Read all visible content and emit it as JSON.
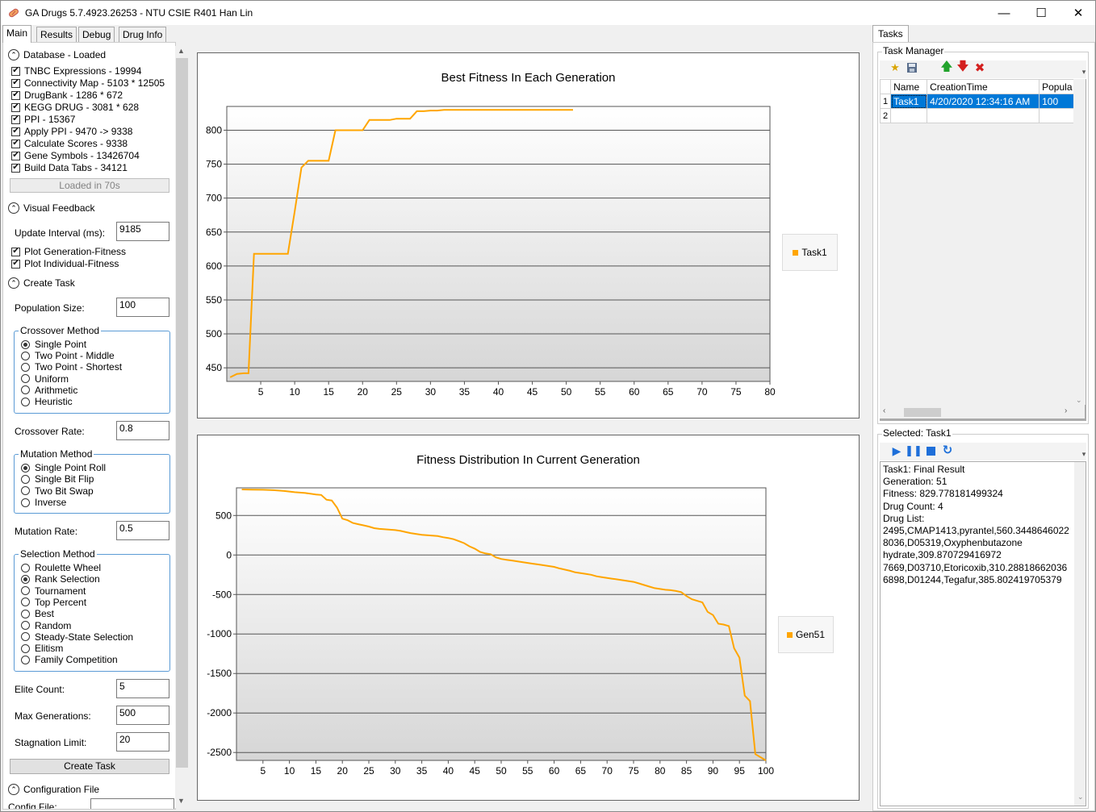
{
  "window": {
    "title": "GA Drugs 5.7.4923.26253 - NTU CSIE R401 Han Lin",
    "minimize": "—",
    "maximize": "☐",
    "close": "✕"
  },
  "tabs": [
    "Main",
    "Results",
    "Debug",
    "Drug Info"
  ],
  "database": {
    "header": "Database - Loaded",
    "items": [
      "TNBC Expressions - 19994",
      "Connectivity Map - 5103 * 12505",
      "DrugBank - 1286 * 672",
      "KEGG DRUG - 3081 * 628",
      "PPI - 15367",
      "Apply PPI - 9470 -> 9338",
      "Calculate Scores - 9338",
      "Gene Symbols - 13426704",
      "Build Data Tabs - 34121"
    ],
    "loaded_button": "Loaded in 70s"
  },
  "visual_feedback": {
    "header": "Visual Feedback",
    "update_interval_label": "Update Interval (ms):",
    "update_interval_value": "9185",
    "plot_generation": "Plot Generation-Fitness",
    "plot_individual": "Plot Individual-Fitness"
  },
  "create_task": {
    "header": "Create Task",
    "population_label": "Population Size:",
    "population_value": "100",
    "crossover_title": "Crossover Method",
    "crossover_options": [
      "Single Point",
      "Two Point - Middle",
      "Two Point - Shortest",
      "Uniform",
      "Arithmetic",
      "Heuristic"
    ],
    "crossover_selected": 0,
    "crossover_rate_label": "Crossover Rate:",
    "crossover_rate_value": "0.8",
    "mutation_title": "Mutation Method",
    "mutation_options": [
      "Single Point Roll",
      "Single Bit Flip",
      "Two Bit Swap",
      "Inverse"
    ],
    "mutation_selected": 0,
    "mutation_rate_label": "Mutation Rate:",
    "mutation_rate_value": "0.5",
    "selection_title": "Selection Method",
    "selection_options": [
      "Roulette Wheel",
      "Rank Selection",
      "Tournament",
      "Top Percent",
      "Best",
      "Random",
      "Steady-State Selection",
      "Elitism",
      "Family Competition"
    ],
    "selection_selected": 1,
    "elite_label": "Elite Count:",
    "elite_value": "5",
    "max_gen_label": "Max Generations:",
    "max_gen_value": "500",
    "stagnation_label": "Stagnation Limit:",
    "stagnation_value": "20",
    "create_button": "Create Task"
  },
  "config": {
    "header": "Configuration File",
    "file_label": "Config File:"
  },
  "chart_data": [
    {
      "type": "line",
      "title": "Best Fitness In Each Generation",
      "xlim": [
        0,
        80
      ],
      "ylim": [
        430,
        835
      ],
      "xticks": [
        5,
        10,
        15,
        20,
        25,
        30,
        35,
        40,
        45,
        50,
        55,
        60,
        65,
        70,
        75,
        80
      ],
      "yticks": [
        450,
        500,
        550,
        600,
        650,
        700,
        750,
        800
      ],
      "grid": true,
      "legend_position": "right",
      "color": "#ffa500",
      "series": [
        {
          "name": "Task1",
          "x": [
            0.5,
            1.5,
            2.5,
            3.2,
            4,
            5,
            6,
            7,
            8,
            9,
            10,
            11,
            12,
            13,
            14,
            15,
            16,
            17,
            18,
            19,
            20,
            21,
            22,
            23,
            24,
            25,
            26,
            27,
            28,
            29,
            30,
            31,
            32,
            33,
            34,
            35,
            36,
            37,
            38,
            39,
            40,
            41,
            42,
            43,
            44,
            45,
            46,
            47,
            48,
            49,
            50,
            51
          ],
          "y": [
            436,
            441,
            442,
            442,
            618,
            618,
            618,
            618,
            618,
            618,
            680,
            745,
            755,
            755,
            755,
            755,
            800,
            800,
            800,
            800,
            800,
            815,
            815,
            815,
            815,
            817,
            817,
            817,
            828,
            828,
            829,
            829,
            830,
            830,
            830,
            830,
            830,
            830,
            830,
            830,
            830,
            830,
            830,
            830,
            830,
            830,
            830,
            830,
            830,
            830,
            830,
            830
          ]
        }
      ]
    },
    {
      "type": "line",
      "title": "Fitness Distribution In Current Generation",
      "xlim": [
        0,
        100
      ],
      "ylim": [
        -2600,
        850
      ],
      "xticks": [
        5,
        10,
        15,
        20,
        25,
        30,
        35,
        40,
        45,
        50,
        55,
        60,
        65,
        70,
        75,
        80,
        85,
        90,
        95,
        100
      ],
      "yticks": [
        500,
        0,
        -500,
        -1000,
        -1500,
        -2000,
        -2500
      ],
      "grid": true,
      "legend_position": "right",
      "color": "#ffa500",
      "series": [
        {
          "name": "Gen51",
          "x": [
            1,
            3,
            5,
            7,
            9,
            11,
            13,
            15,
            16,
            17,
            18,
            19,
            20,
            21,
            22,
            23,
            24,
            25,
            26,
            27,
            28,
            29,
            30,
            31,
            32,
            33,
            34,
            35,
            36,
            37,
            38,
            39,
            40,
            41,
            42,
            43,
            44,
            45,
            46,
            47,
            48,
            49,
            50,
            51,
            52,
            53,
            54,
            55,
            56,
            57,
            58,
            59,
            60,
            61,
            62,
            63,
            64,
            65,
            66,
            67,
            68,
            69,
            70,
            71,
            72,
            73,
            74,
            75,
            76,
            77,
            78,
            79,
            80,
            81,
            82,
            83,
            84,
            85,
            86,
            87,
            88,
            89,
            90,
            91,
            92,
            93,
            94,
            95,
            96,
            97,
            98,
            99,
            100
          ],
          "y": [
            830,
            828,
            825,
            820,
            810,
            795,
            785,
            765,
            760,
            700,
            690,
            600,
            460,
            440,
            405,
            390,
            375,
            360,
            340,
            330,
            325,
            320,
            315,
            305,
            290,
            275,
            265,
            255,
            250,
            245,
            240,
            225,
            215,
            200,
            175,
            150,
            110,
            80,
            40,
            20,
            10,
            -30,
            -50,
            -60,
            -70,
            -80,
            -90,
            -100,
            -110,
            -120,
            -130,
            -140,
            -150,
            -170,
            -185,
            -200,
            -220,
            -230,
            -240,
            -250,
            -270,
            -280,
            -290,
            -300,
            -310,
            -320,
            -330,
            -340,
            -360,
            -380,
            -400,
            -420,
            -430,
            -440,
            -445,
            -455,
            -470,
            -520,
            -560,
            -580,
            -600,
            -720,
            -760,
            -870,
            -880,
            -900,
            -1180,
            -1300,
            -1780,
            -1850,
            -2520,
            -2560,
            -2600
          ]
        }
      ]
    }
  ],
  "tasks_panel": {
    "tab": "Tasks",
    "task_manager_title": "Task Manager",
    "columns": [
      "Name",
      "CreationTime",
      "Popula"
    ],
    "rows": [
      {
        "index": "1",
        "name": "Task1",
        "time": "4/20/2020 12:34:16 AM",
        "population": "100"
      },
      {
        "index": "2",
        "name": "",
        "time": "",
        "population": ""
      }
    ],
    "selected_title": "Selected: Task1",
    "result_lines": [
      "Task1: Final Result",
      "Generation: 51",
      "Fitness: 829.778181499324",
      "Drug Count: 4",
      "Drug List:",
      "2495,CMAP1413,pyrantel,560.3448646022",
      "8036,D05319,Oxyphenbutazone",
      "hydrate,309.870729416972",
      "7669,D03710,Etoricoxib,310.28818662036",
      "6898,D01244,Tegafur,385.802419705379"
    ]
  },
  "colors": {
    "accent": "#0078d7",
    "series": "#ffa500",
    "group_border": "#5b9bd5"
  }
}
